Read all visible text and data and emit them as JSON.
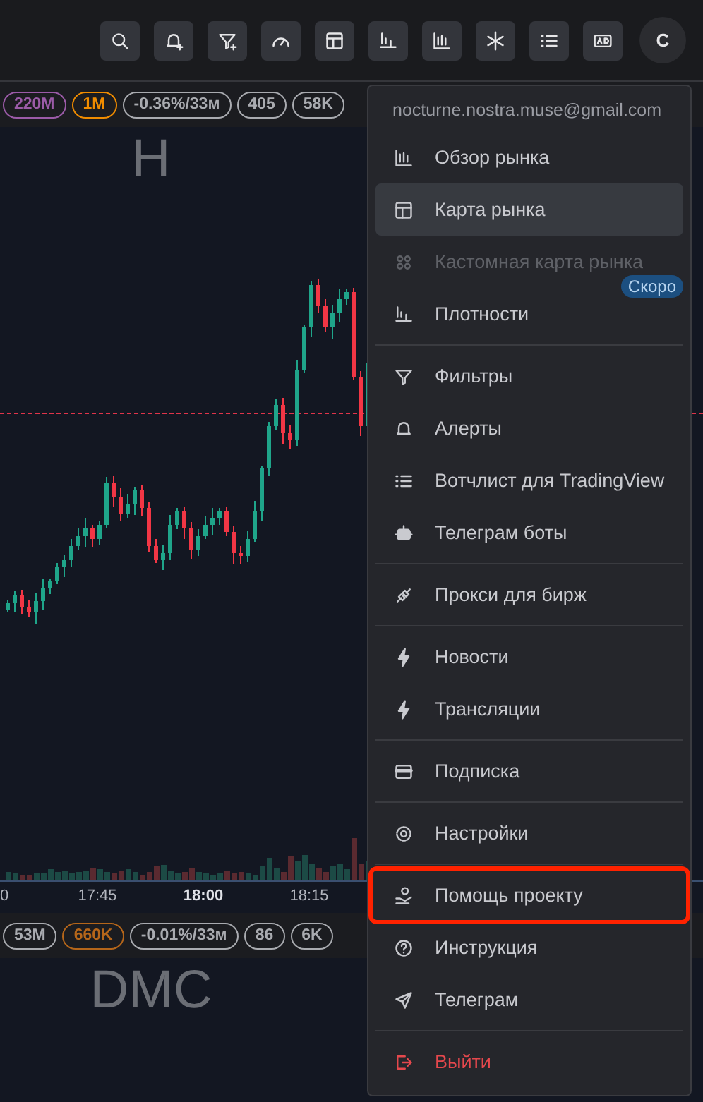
{
  "toolbar": {
    "avatar": "C"
  },
  "panels": [
    {
      "ticker": "H",
      "chips": [
        {
          "text": "220M",
          "color": "#9b5ba8"
        },
        {
          "text": "1M",
          "color": "#f08c00"
        },
        {
          "text": "-0.36%/33м",
          "color": "#a9abb0"
        },
        {
          "text": "405",
          "color": "#a9abb0"
        },
        {
          "text": "58K",
          "color": "#a9abb0"
        }
      ],
      "time_labels": [
        {
          "text": "0",
          "bold": false
        },
        {
          "text": "17:45",
          "bold": false
        },
        {
          "text": "18:00",
          "bold": true
        },
        {
          "text": "18:15",
          "bold": false
        }
      ]
    },
    {
      "ticker": "DMC",
      "chips": [
        {
          "text": "53M",
          "color": "#a9abb0"
        },
        {
          "text": "660K",
          "color": "#b5661a"
        },
        {
          "text": "-0.01%/33м",
          "color": "#a9abb0"
        },
        {
          "text": "86",
          "color": "#a9abb0"
        },
        {
          "text": "6K",
          "color": "#a9abb0"
        }
      ]
    }
  ],
  "menu": {
    "email": "nocturne.nostra.muse@gmail.com",
    "groups": [
      [
        {
          "label": "Обзор рынка",
          "kind": "normal",
          "selected": false,
          "disabled": false,
          "highlighted": false
        },
        {
          "label": "Карта рынка",
          "kind": "normal",
          "selected": true,
          "disabled": false,
          "highlighted": false
        },
        {
          "label": "Кастомная карта рынка",
          "kind": "normal",
          "selected": false,
          "disabled": true,
          "highlighted": false,
          "badge": "Скоро"
        },
        {
          "label": "Плотности",
          "kind": "normal",
          "selected": false,
          "disabled": false,
          "highlighted": false
        }
      ],
      [
        {
          "label": "Фильтры",
          "kind": "normal",
          "selected": false,
          "disabled": false,
          "highlighted": false
        },
        {
          "label": "Алерты",
          "kind": "normal",
          "selected": false,
          "disabled": false,
          "highlighted": false
        },
        {
          "label": "Вотчлист для TradingView",
          "kind": "normal",
          "selected": false,
          "disabled": false,
          "highlighted": false
        },
        {
          "label": "Телеграм боты",
          "kind": "normal",
          "selected": false,
          "disabled": false,
          "highlighted": false
        }
      ],
      [
        {
          "label": "Прокси для бирж",
          "kind": "normal",
          "selected": false,
          "disabled": false,
          "highlighted": false
        }
      ],
      [
        {
          "label": "Новости",
          "kind": "normal",
          "selected": false,
          "disabled": false,
          "highlighted": false
        },
        {
          "label": "Трансляции",
          "kind": "normal",
          "selected": false,
          "disabled": false,
          "highlighted": false
        }
      ],
      [
        {
          "label": "Подписка",
          "kind": "normal",
          "selected": false,
          "disabled": false,
          "highlighted": false
        }
      ],
      [
        {
          "label": "Настройки",
          "kind": "normal",
          "selected": false,
          "disabled": false,
          "highlighted": false
        }
      ],
      [
        {
          "label": "Помощь проекту",
          "kind": "normal",
          "selected": false,
          "disabled": false,
          "highlighted": true
        },
        {
          "label": "Инструкция",
          "kind": "normal",
          "selected": false,
          "disabled": false,
          "highlighted": false
        },
        {
          "label": "Телеграм",
          "kind": "normal",
          "selected": false,
          "disabled": false,
          "highlighted": false
        }
      ],
      [
        {
          "label": "Выйти",
          "kind": "danger",
          "selected": false,
          "disabled": false,
          "highlighted": false
        }
      ]
    ]
  }
}
